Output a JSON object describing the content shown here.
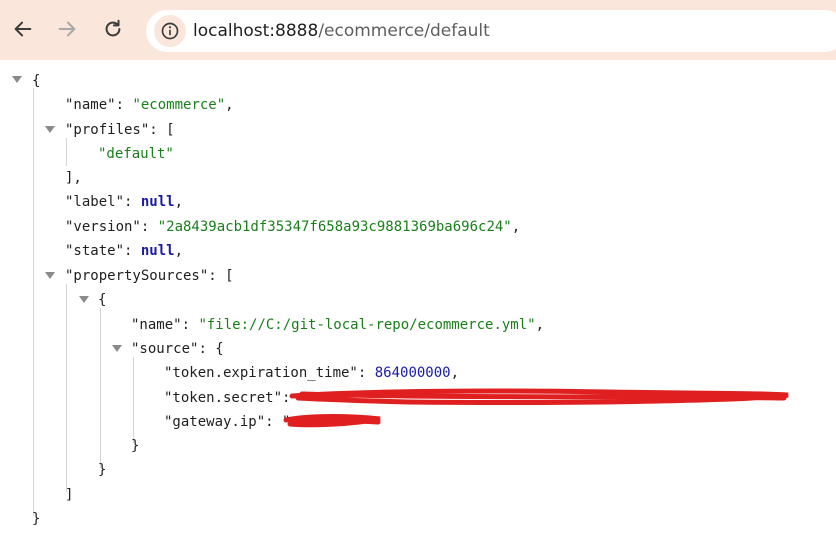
{
  "browser": {
    "url_host": "localhost:8888",
    "url_path": "/ecommerce/default"
  },
  "icons": [
    "back-arrow-icon",
    "forward-arrow-icon",
    "reload-icon",
    "site-info-icon",
    "collapse-arrow-icon"
  ],
  "colors": {
    "toolbar": "#fbe6dc",
    "string": "#1a7f1a",
    "number_keyword": "#1a1aa6",
    "redaction": "#e02020"
  },
  "json": {
    "brace_open": "{",
    "name_key": "\"name\"",
    "name_val": "\"ecommerce\"",
    "profiles_key": "\"profiles\"",
    "profiles_item": "\"default\"",
    "label_key": "\"label\"",
    "label_val": "null",
    "version_key": "\"version\"",
    "version_val": "\"2a8439acb1df35347f658a93c9881369ba696c24\"",
    "state_key": "\"state\"",
    "state_val": "null",
    "property_sources_key": "\"propertySources\"",
    "ps_name_key": "\"name\"",
    "ps_name_val": "\"file://C:/git-local-repo/ecommerce.yml\"",
    "source_key": "\"source\"",
    "token_expiration_key": "\"token.expiration_time\"",
    "token_expiration_val": "864000000",
    "token_secret_key": "\"token.secret\"",
    "token_secret_val": "\"[redacted]\"",
    "gateway_ip_key": "\"gateway.ip\"",
    "gateway_ip_val": "\"[redacted]\""
  }
}
